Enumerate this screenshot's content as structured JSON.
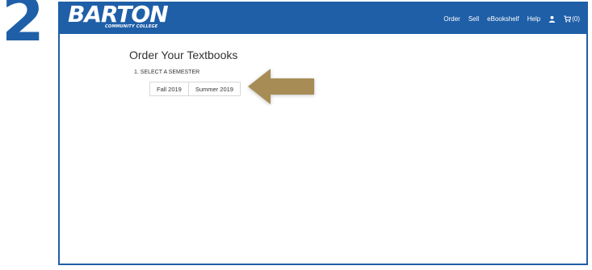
{
  "step_number": "2",
  "colors": {
    "brand_blue": "#1f5fa8",
    "arrow_gold": "#a78d55"
  },
  "header": {
    "logo_text": "BARTON",
    "logo_subtext": "COMMUNITY COLLEGE",
    "nav": {
      "order": "Order",
      "sell": "Sell",
      "ebookshelf": "eBookshelf",
      "help": "Help",
      "account_icon": "user-icon",
      "cart_icon": "cart-icon",
      "cart_count": "(0)"
    }
  },
  "main": {
    "title": "Order Your Textbooks",
    "step_label": "1. SELECT A SEMESTER",
    "semesters": [
      "Fall 2019",
      "Summer 2019"
    ]
  },
  "annotation": {
    "arrow_icon": "arrow-left-icon"
  }
}
